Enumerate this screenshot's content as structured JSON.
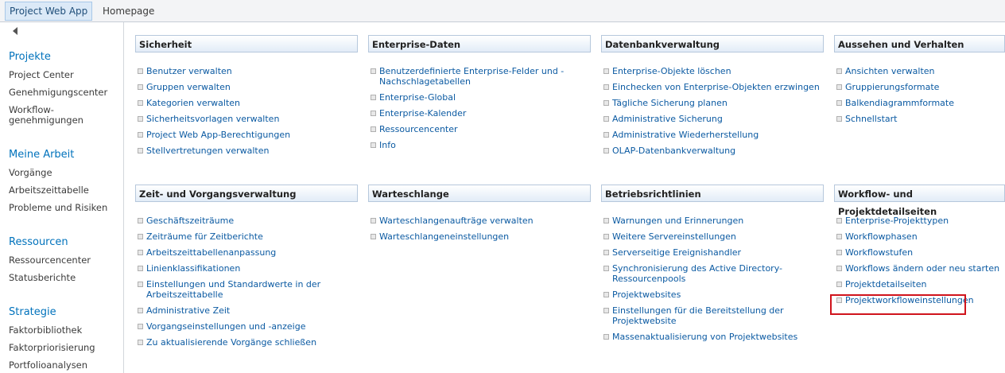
{
  "topbar": {
    "active_tab": "Project Web App",
    "home_tab": "Homepage"
  },
  "leftnav": {
    "groups": [
      {
        "heading": "Projekte",
        "items": [
          "Project Center",
          "Genehmigungscenter",
          "Workflow-\ngenehmigungen"
        ]
      },
      {
        "heading": "Meine Arbeit",
        "items": [
          "Vorgänge",
          "Arbeitszeittabelle",
          "Probleme und Risiken"
        ]
      },
      {
        "heading": "Ressourcen",
        "items": [
          "Ressourcencenter",
          "Statusberichte"
        ]
      },
      {
        "heading": "Strategie",
        "items": [
          "Faktorbibliothek",
          "Faktorpriorisierung",
          "Portfolioanalysen"
        ]
      }
    ]
  },
  "sections": [
    {
      "title": "Sicherheit",
      "links": [
        "Benutzer verwalten",
        "Gruppen verwalten",
        "Kategorien verwalten",
        "Sicherheitsvorlagen verwalten",
        "Project Web App-Berechtigungen",
        "Stellvertretungen verwalten"
      ]
    },
    {
      "title": "Enterprise-Daten",
      "links": [
        "Benutzerdefinierte Enterprise-Felder und -\nNachschlagetabellen",
        "Enterprise-Global",
        "Enterprise-Kalender",
        "Ressourcencenter",
        "Info"
      ]
    },
    {
      "title": "Datenbankverwaltung",
      "links": [
        "Enterprise-Objekte löschen",
        "Einchecken von Enterprise-Objekten erzwingen",
        "Tägliche Sicherung planen",
        "Administrative Sicherung",
        "Administrative Wiederherstellung",
        "OLAP-Datenbankverwaltung"
      ]
    },
    {
      "title": "Aussehen und Verhalten",
      "links": [
        "Ansichten verwalten",
        "Gruppierungsformate",
        "Balkendiagrammformate",
        "Schnellstart"
      ]
    },
    {
      "title": "Zeit- und Vorgangsverwaltung",
      "links": [
        "Geschäftszeiträume",
        "Zeiträume für Zeitberichte",
        "Arbeitszeittabellenanpassung",
        "Linienklassifikationen",
        "Einstellungen und Standardwerte in der\nArbeitszeittabelle",
        "Administrative Zeit",
        "Vorgangseinstellungen und -anzeige",
        "Zu aktualisierende Vorgänge schließen"
      ]
    },
    {
      "title": "Warteschlange",
      "links": [
        "Warteschlangenaufträge verwalten",
        "Warteschlangeneinstellungen"
      ]
    },
    {
      "title": "Betriebsrichtlinien",
      "links": [
        "Warnungen und Erinnerungen",
        "Weitere Servereinstellungen",
        "Serverseitige Ereignishandler",
        "Synchronisierung des Active Directory-\nRessourcenpools",
        "Projektwebsites",
        "Einstellungen für die Bereitstellung der Projektwebsite",
        "Massenaktualisierung von Projektwebsites"
      ]
    },
    {
      "title": "Workflow- und Projektdetailseiten",
      "links": [
        "Enterprise-Projekttypen",
        "Workflowphasen",
        "Workflowstufen",
        "Workflows ändern oder neu starten",
        "Projektdetailseiten",
        "Projektworkfloweinstellungen"
      ]
    }
  ],
  "colors": {
    "link": "#0b5aa2",
    "nav_heading": "#0072bc",
    "highlight": "#d0141c"
  }
}
